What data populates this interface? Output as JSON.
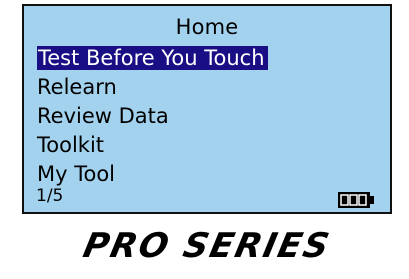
{
  "screen": {
    "title": "Home",
    "menu_items": [
      {
        "label": "Test Before You Touch",
        "selected": true
      },
      {
        "label": "Relearn",
        "selected": false
      },
      {
        "label": "Review Data",
        "selected": false
      },
      {
        "label": "Toolkit",
        "selected": false
      },
      {
        "label": "My Tool",
        "selected": false
      }
    ],
    "page_indicator": "1/5",
    "battery_icon": "battery-icon",
    "background_color": "#a2d2ee",
    "highlight_color": "#1a0e84"
  },
  "brand": {
    "logo_text": "PRO SERIES"
  }
}
